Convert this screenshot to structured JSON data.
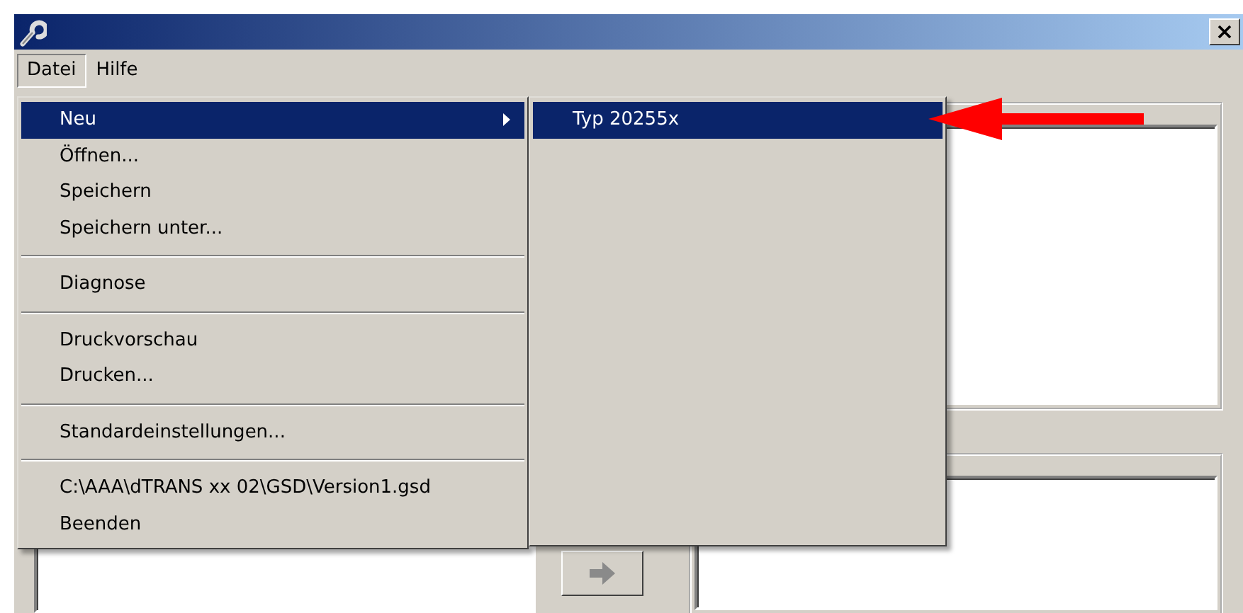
{
  "menu_bar": [
    {
      "label": "Datei",
      "selected": true
    },
    {
      "label": "Hilfe",
      "selected": false
    }
  ],
  "file_menu": [
    {
      "kind": "item",
      "label": "Neu",
      "selected": true,
      "submenu": true
    },
    {
      "kind": "item",
      "label": "Öffnen...",
      "selected": false,
      "submenu": false
    },
    {
      "kind": "item",
      "label": "Speichern",
      "selected": false,
      "submenu": false
    },
    {
      "kind": "item",
      "label": "Speichern unter...",
      "selected": false,
      "submenu": false
    },
    {
      "kind": "separator"
    },
    {
      "kind": "item",
      "label": "Diagnose",
      "selected": false,
      "submenu": false
    },
    {
      "kind": "separator"
    },
    {
      "kind": "item",
      "label": "Druckvorschau",
      "selected": false,
      "submenu": false
    },
    {
      "kind": "item",
      "label": "Drucken...",
      "selected": false,
      "submenu": false
    },
    {
      "kind": "separator"
    },
    {
      "kind": "item",
      "label": "Standardeinstellungen...",
      "selected": false,
      "submenu": false
    },
    {
      "kind": "separator"
    },
    {
      "kind": "item",
      "label": "C:\\AAA\\dTRANS xx 02\\GSD\\Version1.gsd",
      "selected": false,
      "submenu": false
    },
    {
      "kind": "item",
      "label": "Beenden",
      "selected": false,
      "submenu": false
    }
  ],
  "new_submenu": [
    {
      "label": "Typ 20255x",
      "selected": true
    }
  ],
  "transfer_button": {
    "disabled": true
  }
}
